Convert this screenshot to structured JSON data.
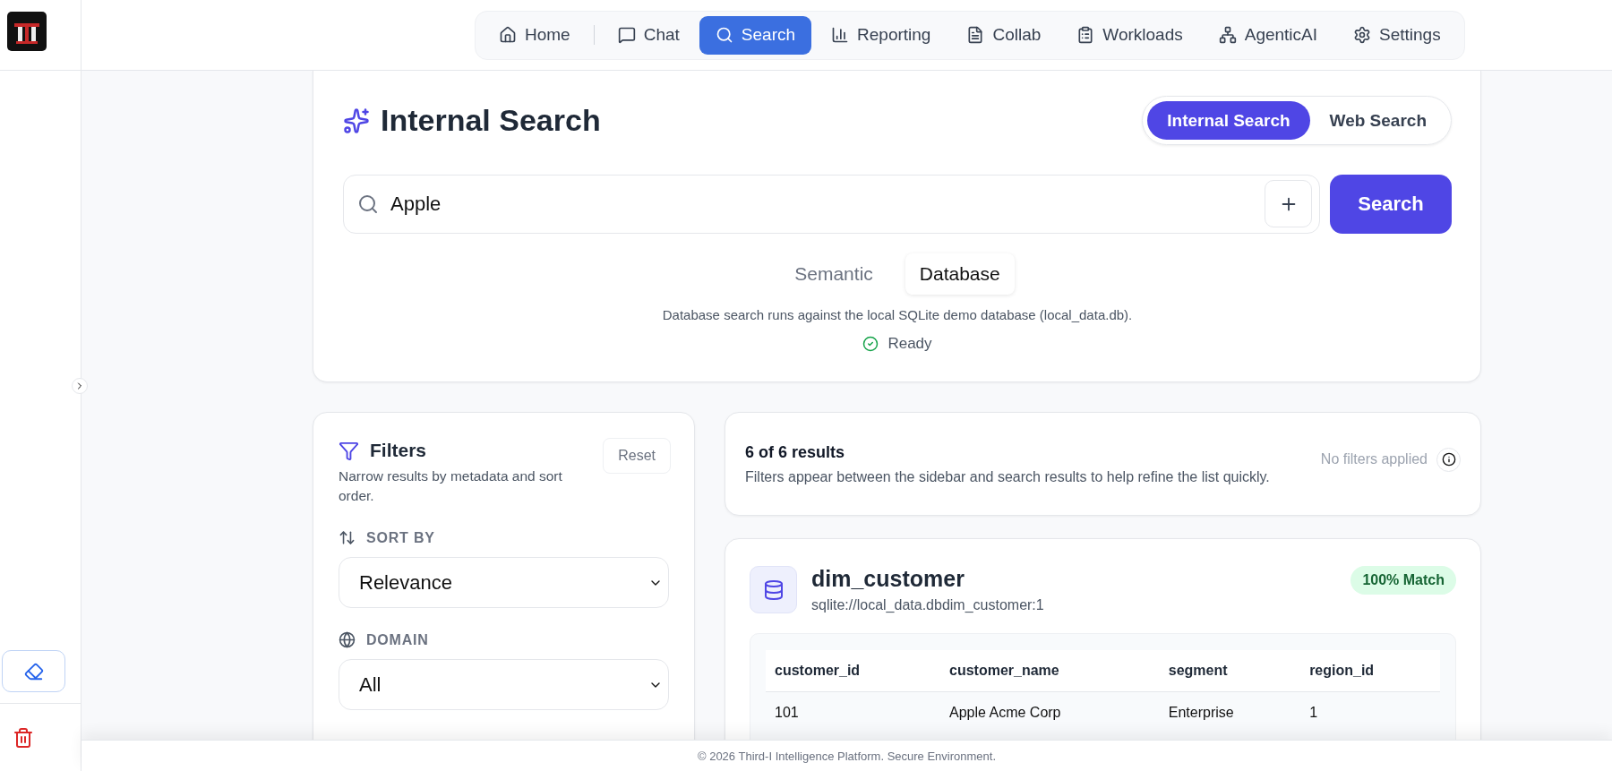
{
  "nav": {
    "items": [
      {
        "label": "Home",
        "selected": false
      },
      {
        "label": "Chat",
        "selected": false
      },
      {
        "label": "Search",
        "selected": true
      },
      {
        "label": "Reporting",
        "selected": false
      },
      {
        "label": "Collab",
        "selected": false
      },
      {
        "label": "Workloads",
        "selected": false
      },
      {
        "label": "AgenticAI",
        "selected": false
      },
      {
        "label": "Settings",
        "selected": false
      }
    ]
  },
  "search_panel": {
    "title": "Internal Search",
    "scope_tabs": [
      {
        "label": "Internal Search",
        "selected": true
      },
      {
        "label": "Web Search",
        "selected": false
      }
    ],
    "query": "Apple",
    "search_button": "Search",
    "modes": [
      {
        "label": "Semantic",
        "selected": false
      },
      {
        "label": "Database",
        "selected": true
      }
    ],
    "description": "Database search runs against the local SQLite demo database (local_data.db).",
    "status": "Ready"
  },
  "filters": {
    "title": "Filters",
    "reset": "Reset",
    "subtitle": "Narrow results by metadata and sort order.",
    "groups": [
      {
        "label": "SORT BY",
        "value": "Relevance"
      },
      {
        "label": "DOMAIN",
        "value": "All"
      }
    ]
  },
  "summary": {
    "count": "6 of 6 results",
    "hint": "Filters appear between the sidebar and search results to help refine the list quickly.",
    "filters_status": "No filters applied"
  },
  "results": [
    {
      "title": "dim_customer",
      "source": "sqlite://local_data.dbdim_customer:1",
      "match": "100% Match",
      "columns": [
        "customer_id",
        "customer_name",
        "segment",
        "region_id"
      ],
      "rows": [
        [
          "101",
          "Apple Acme Corp",
          "Enterprise",
          "1"
        ]
      ]
    }
  ],
  "footer": "© 2026 Third-I Intelligence Platform. Secure Environment."
}
